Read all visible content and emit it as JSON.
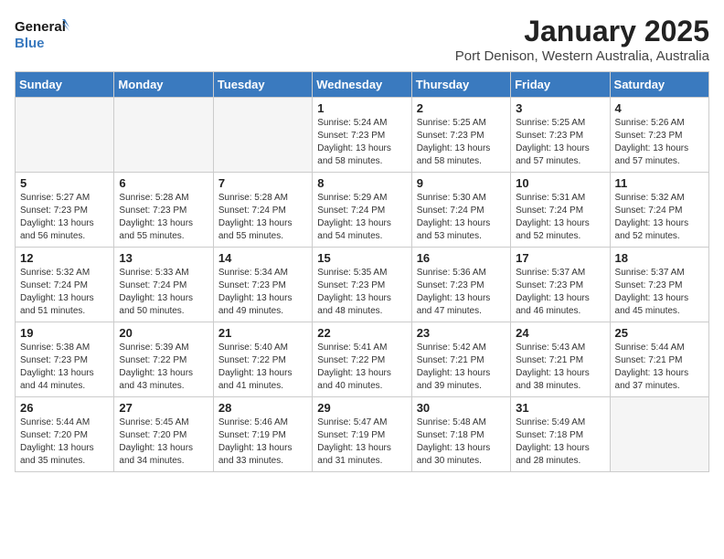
{
  "header": {
    "logo_line1": "General",
    "logo_line2": "Blue",
    "month": "January 2025",
    "location": "Port Denison, Western Australia, Australia"
  },
  "weekdays": [
    "Sunday",
    "Monday",
    "Tuesday",
    "Wednesday",
    "Thursday",
    "Friday",
    "Saturday"
  ],
  "weeks": [
    [
      {
        "day": "",
        "sunrise": "",
        "sunset": "",
        "daylight": ""
      },
      {
        "day": "",
        "sunrise": "",
        "sunset": "",
        "daylight": ""
      },
      {
        "day": "",
        "sunrise": "",
        "sunset": "",
        "daylight": ""
      },
      {
        "day": "1",
        "sunrise": "Sunrise: 5:24 AM",
        "sunset": "Sunset: 7:23 PM",
        "daylight": "Daylight: 13 hours and 58 minutes."
      },
      {
        "day": "2",
        "sunrise": "Sunrise: 5:25 AM",
        "sunset": "Sunset: 7:23 PM",
        "daylight": "Daylight: 13 hours and 58 minutes."
      },
      {
        "day": "3",
        "sunrise": "Sunrise: 5:25 AM",
        "sunset": "Sunset: 7:23 PM",
        "daylight": "Daylight: 13 hours and 57 minutes."
      },
      {
        "day": "4",
        "sunrise": "Sunrise: 5:26 AM",
        "sunset": "Sunset: 7:23 PM",
        "daylight": "Daylight: 13 hours and 57 minutes."
      }
    ],
    [
      {
        "day": "5",
        "sunrise": "Sunrise: 5:27 AM",
        "sunset": "Sunset: 7:23 PM",
        "daylight": "Daylight: 13 hours and 56 minutes."
      },
      {
        "day": "6",
        "sunrise": "Sunrise: 5:28 AM",
        "sunset": "Sunset: 7:23 PM",
        "daylight": "Daylight: 13 hours and 55 minutes."
      },
      {
        "day": "7",
        "sunrise": "Sunrise: 5:28 AM",
        "sunset": "Sunset: 7:24 PM",
        "daylight": "Daylight: 13 hours and 55 minutes."
      },
      {
        "day": "8",
        "sunrise": "Sunrise: 5:29 AM",
        "sunset": "Sunset: 7:24 PM",
        "daylight": "Daylight: 13 hours and 54 minutes."
      },
      {
        "day": "9",
        "sunrise": "Sunrise: 5:30 AM",
        "sunset": "Sunset: 7:24 PM",
        "daylight": "Daylight: 13 hours and 53 minutes."
      },
      {
        "day": "10",
        "sunrise": "Sunrise: 5:31 AM",
        "sunset": "Sunset: 7:24 PM",
        "daylight": "Daylight: 13 hours and 52 minutes."
      },
      {
        "day": "11",
        "sunrise": "Sunrise: 5:32 AM",
        "sunset": "Sunset: 7:24 PM",
        "daylight": "Daylight: 13 hours and 52 minutes."
      }
    ],
    [
      {
        "day": "12",
        "sunrise": "Sunrise: 5:32 AM",
        "sunset": "Sunset: 7:24 PM",
        "daylight": "Daylight: 13 hours and 51 minutes."
      },
      {
        "day": "13",
        "sunrise": "Sunrise: 5:33 AM",
        "sunset": "Sunset: 7:24 PM",
        "daylight": "Daylight: 13 hours and 50 minutes."
      },
      {
        "day": "14",
        "sunrise": "Sunrise: 5:34 AM",
        "sunset": "Sunset: 7:23 PM",
        "daylight": "Daylight: 13 hours and 49 minutes."
      },
      {
        "day": "15",
        "sunrise": "Sunrise: 5:35 AM",
        "sunset": "Sunset: 7:23 PM",
        "daylight": "Daylight: 13 hours and 48 minutes."
      },
      {
        "day": "16",
        "sunrise": "Sunrise: 5:36 AM",
        "sunset": "Sunset: 7:23 PM",
        "daylight": "Daylight: 13 hours and 47 minutes."
      },
      {
        "day": "17",
        "sunrise": "Sunrise: 5:37 AM",
        "sunset": "Sunset: 7:23 PM",
        "daylight": "Daylight: 13 hours and 46 minutes."
      },
      {
        "day": "18",
        "sunrise": "Sunrise: 5:37 AM",
        "sunset": "Sunset: 7:23 PM",
        "daylight": "Daylight: 13 hours and 45 minutes."
      }
    ],
    [
      {
        "day": "19",
        "sunrise": "Sunrise: 5:38 AM",
        "sunset": "Sunset: 7:23 PM",
        "daylight": "Daylight: 13 hours and 44 minutes."
      },
      {
        "day": "20",
        "sunrise": "Sunrise: 5:39 AM",
        "sunset": "Sunset: 7:22 PM",
        "daylight": "Daylight: 13 hours and 43 minutes."
      },
      {
        "day": "21",
        "sunrise": "Sunrise: 5:40 AM",
        "sunset": "Sunset: 7:22 PM",
        "daylight": "Daylight: 13 hours and 41 minutes."
      },
      {
        "day": "22",
        "sunrise": "Sunrise: 5:41 AM",
        "sunset": "Sunset: 7:22 PM",
        "daylight": "Daylight: 13 hours and 40 minutes."
      },
      {
        "day": "23",
        "sunrise": "Sunrise: 5:42 AM",
        "sunset": "Sunset: 7:21 PM",
        "daylight": "Daylight: 13 hours and 39 minutes."
      },
      {
        "day": "24",
        "sunrise": "Sunrise: 5:43 AM",
        "sunset": "Sunset: 7:21 PM",
        "daylight": "Daylight: 13 hours and 38 minutes."
      },
      {
        "day": "25",
        "sunrise": "Sunrise: 5:44 AM",
        "sunset": "Sunset: 7:21 PM",
        "daylight": "Daylight: 13 hours and 37 minutes."
      }
    ],
    [
      {
        "day": "26",
        "sunrise": "Sunrise: 5:44 AM",
        "sunset": "Sunset: 7:20 PM",
        "daylight": "Daylight: 13 hours and 35 minutes."
      },
      {
        "day": "27",
        "sunrise": "Sunrise: 5:45 AM",
        "sunset": "Sunset: 7:20 PM",
        "daylight": "Daylight: 13 hours and 34 minutes."
      },
      {
        "day": "28",
        "sunrise": "Sunrise: 5:46 AM",
        "sunset": "Sunset: 7:19 PM",
        "daylight": "Daylight: 13 hours and 33 minutes."
      },
      {
        "day": "29",
        "sunrise": "Sunrise: 5:47 AM",
        "sunset": "Sunset: 7:19 PM",
        "daylight": "Daylight: 13 hours and 31 minutes."
      },
      {
        "day": "30",
        "sunrise": "Sunrise: 5:48 AM",
        "sunset": "Sunset: 7:18 PM",
        "daylight": "Daylight: 13 hours and 30 minutes."
      },
      {
        "day": "31",
        "sunrise": "Sunrise: 5:49 AM",
        "sunset": "Sunset: 7:18 PM",
        "daylight": "Daylight: 13 hours and 28 minutes."
      },
      {
        "day": "",
        "sunrise": "",
        "sunset": "",
        "daylight": ""
      }
    ]
  ]
}
